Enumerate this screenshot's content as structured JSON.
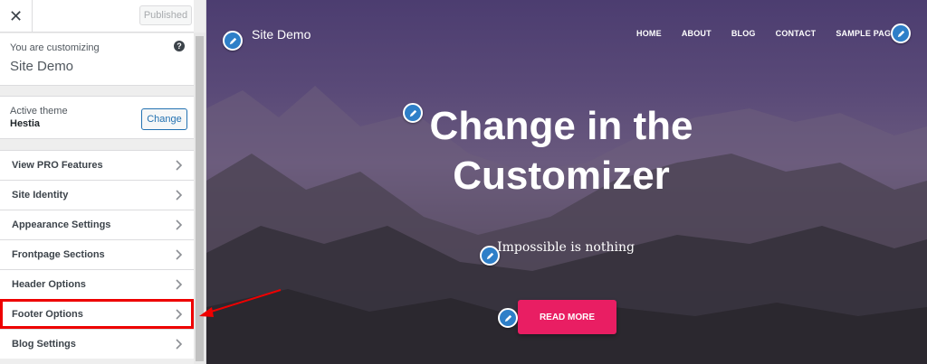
{
  "sidebar": {
    "close_symbol": "✕",
    "published_label": "Published",
    "customizing_label": "You are customizing",
    "site_name": "Site Demo",
    "help_symbol": "?",
    "active_theme_label": "Active theme",
    "theme_name": "Hestia",
    "change_label": "Change",
    "items": [
      {
        "label": "View PRO Features"
      },
      {
        "label": "Site Identity"
      },
      {
        "label": "Appearance Settings"
      },
      {
        "label": "Frontpage Sections"
      },
      {
        "label": "Header Options"
      },
      {
        "label": "Footer Options"
      },
      {
        "label": "Blog Settings"
      }
    ]
  },
  "preview": {
    "site_title": "Site Demo",
    "nav": [
      "HOME",
      "ABOUT",
      "BLOG",
      "CONTACT",
      "SAMPLE PAGE"
    ],
    "hero_title_line1": "Change in the",
    "hero_title_line2": "Customizer",
    "hero_subtitle": "Impossible is nothing",
    "cta_label": "READ MORE"
  },
  "colors": {
    "accent": "#e91e63",
    "edit_icon": "#2e7fc8",
    "highlight": "#ee0000",
    "wp_blue": "#2271b1"
  }
}
